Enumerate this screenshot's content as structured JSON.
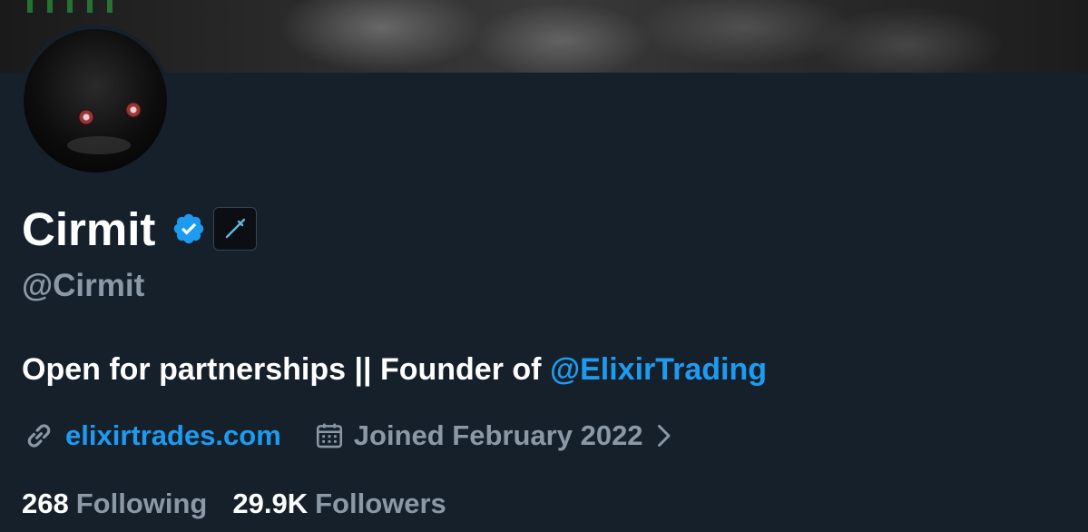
{
  "profile": {
    "display_name": "Cirmit",
    "handle": "@Cirmit",
    "bio_text": "Open for partnerships || Founder of ",
    "bio_mention": "@ElixirTrading",
    "website": "elixirtrades.com",
    "joined": "Joined February 2022",
    "following_count": "268",
    "following_label": "Following",
    "followers_count": "29.9K",
    "followers_label": "Followers"
  },
  "icons": {
    "verified": "verified-badge-icon",
    "affiliate": "affiliate-syringe-icon",
    "website": "link-icon",
    "joined": "calendar-icon",
    "more": "chevron-right-icon"
  },
  "colors": {
    "background": "#15202b",
    "accent": "#1d9bf0",
    "secondary_text": "#8b98a5",
    "primary_text": "#ffffff"
  }
}
